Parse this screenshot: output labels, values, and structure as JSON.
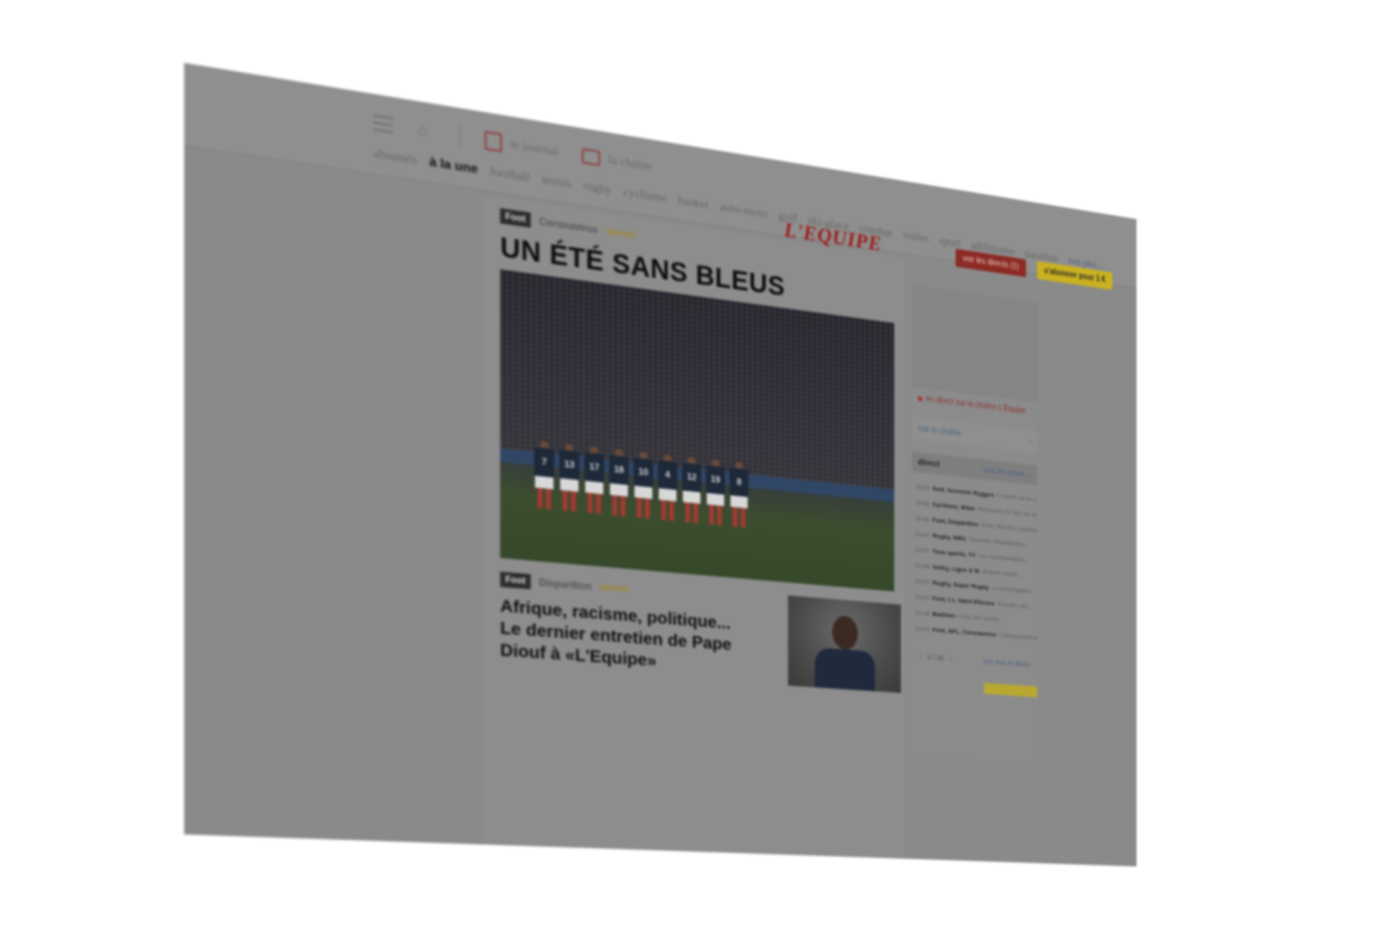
{
  "toolbar": {
    "journal_label": "le journal",
    "chaine_label": "la chaîne"
  },
  "nav": {
    "items": [
      "abonnés",
      "à la une",
      "football",
      "tennis",
      "rugby",
      "cyclisme",
      "basket",
      "auto-moto",
      "golf",
      "ski-glace",
      "combat",
      "voiles",
      "sport",
      "athlétisme",
      "natation"
    ],
    "active_index": 1,
    "more_label": "voir plus..."
  },
  "brand": {
    "logo_text": "L'EQUIPE",
    "red_button_label": "voir les directs (1)",
    "yellow_button_label": "s'abonner pour 1 €",
    "colors": {
      "logo": "#9c1b17",
      "red_button": "#8c2a24",
      "yellow_button": "#c9b11f"
    }
  },
  "main_article": {
    "tag": "Foot",
    "kicker": "Coronavirus",
    "abonne": "abonné",
    "headline": "UN ÉTÉ SANS BLEUS",
    "jersey_numbers": [
      "7",
      "13",
      "17",
      "18",
      "10",
      "4",
      "12",
      "19",
      "8"
    ]
  },
  "second_article": {
    "tag": "Foot",
    "kicker": "Disparition",
    "abonne": "abonné",
    "title": "Afrique, racisme, politique... Le dernier entretien de Pape Diouf à «L'Equipe»"
  },
  "sidebar": {
    "live_text": "en direct sur la chaîne L'Équipe",
    "see_channel_label": "voir la chaîne",
    "direct_title": "direct",
    "filter_label": "tous les sports",
    "feed": [
      {
        "time": "15:49",
        "sport": "Golf, Seonmin Ryggen",
        "text": "L'ombre de la course..."
      },
      {
        "time": "15:46",
        "sport": "Cyclisme, Bilan",
        "text": "Rencontre le Giro de la..."
      },
      {
        "time": "15:46",
        "sport": "Foot, Disparition",
        "text": "Sous discutés, passés..."
      },
      {
        "time": "15:42",
        "sport": "Rugby, MRC",
        "text": "Nouvelle officialisation..."
      },
      {
        "time": "15:37",
        "sport": "Tous sports, TV",
        "text": "Les commentaires..."
      },
      {
        "time": "15:36",
        "sport": "Volley, Ligue A W",
        "text": "Bulletin repart..."
      },
      {
        "time": "15:23",
        "sport": "Rugby, Super Rugby",
        "text": "La prolongation..."
      },
      {
        "time": "15:22",
        "sport": "Foot, L1, Saint-Étienne",
        "text": "Bouclier des..."
      },
      {
        "time": "15:18",
        "sport": "Biathlon",
        "text": "Cara des sports..."
      },
      {
        "time": "15:09",
        "sport": "Foot, AFL, Coronavirus",
        "text": "Championnat le..."
      }
    ],
    "pager_text": "1 / 10",
    "see_all_label": "voir tout le direct"
  }
}
